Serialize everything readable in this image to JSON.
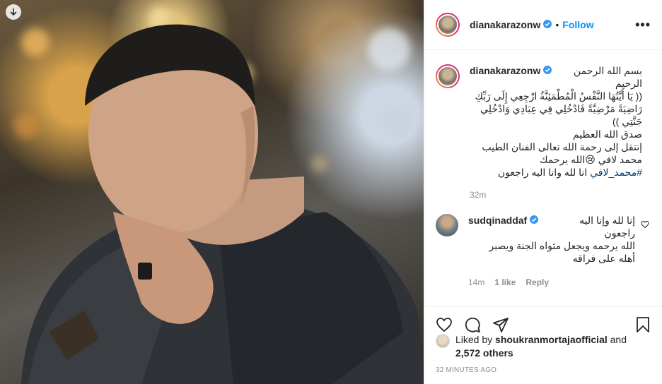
{
  "post": {
    "username": "dianakarazonw",
    "follow_label": "Follow",
    "separator": "•",
    "more_label": "•••"
  },
  "caption": {
    "username": "dianakarazonw",
    "first_line": "بسم الله الرحمن",
    "lines": [
      "الرحيم",
      "(( يَا أَيَّتُهَا النَّفْسُ الْمُطْمَئِنَّةُ ارْجِعِي إِلَى رَبِّكِ",
      "رَاضِيَةً مَرْضِيَّةً فَادْخُلِي فِي عِبَادِي وَادْخُلِي",
      "جَنَّتِي ))",
      "صدق الله العظيم",
      "إنتقل إلى رحمة الله تعالى الفنان الطيب",
      "محمد لافي 😢الله يرحمك"
    ],
    "hashtag": "#محمد_لافي",
    "hashtag_suffix": "  انا لله وانا اليه راجعون",
    "time": "32m"
  },
  "comment": {
    "username": "sudqinaddaf",
    "first_line": "إنا لله وإنا اليه",
    "lines": [
      "راجعون",
      "الله يرحمه ويجعل مثواه الجنة ويصبر",
      "أهله على فراقه"
    ],
    "time": "14m",
    "likes": "1 like",
    "reply": "Reply"
  },
  "likes": {
    "prefix": "Liked by ",
    "user": "shoukranmortajaofficial",
    "and": " and",
    "others": "2,572 others"
  },
  "timestamp": "32 minutes ago",
  "colors": {
    "accent": "#0095f6",
    "verified": "#3897f0",
    "muted": "#8e8e8e",
    "hashtag": "#00376b"
  }
}
